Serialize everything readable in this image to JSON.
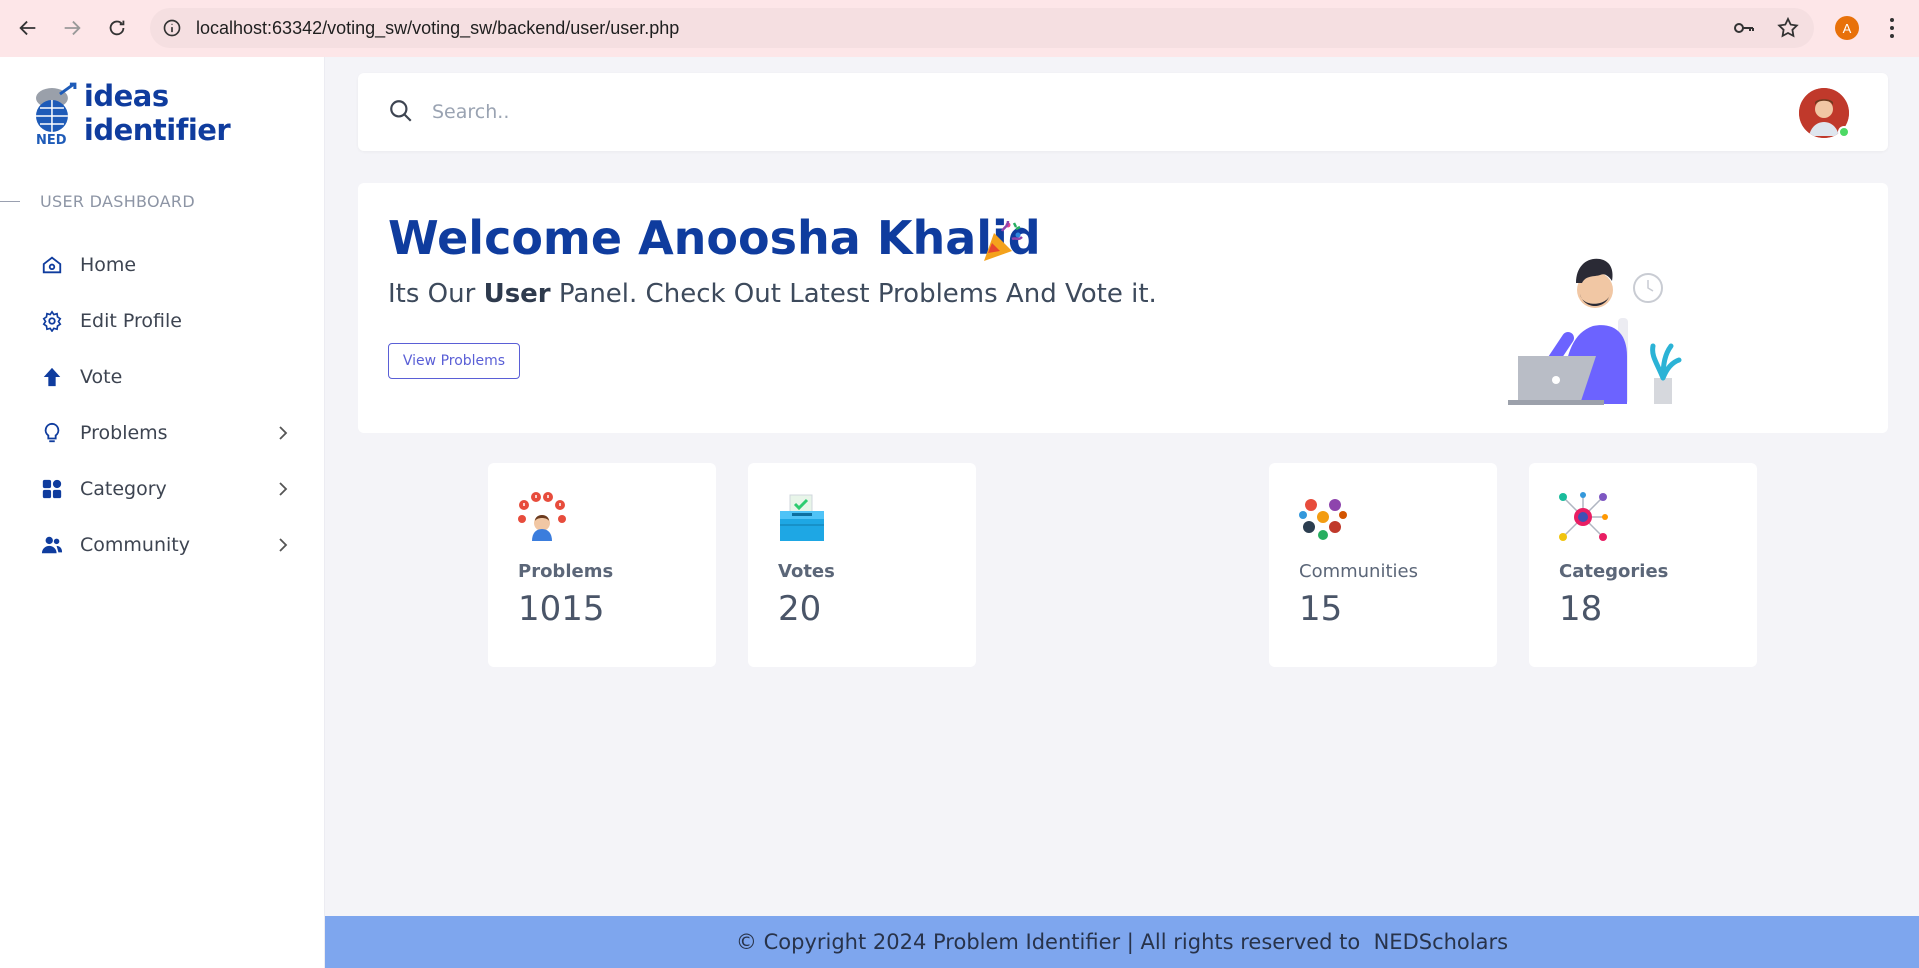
{
  "browser": {
    "url": "localhost:63342/voting_sw/voting_sw/backend/user/user.php",
    "profile_initial": "A"
  },
  "sidebar": {
    "brand_name": "ideas identifier",
    "section_title": "USER DASHBOARD",
    "items": [
      {
        "label": "Home",
        "icon": "home-icon",
        "has_chevron": false
      },
      {
        "label": "Edit Profile",
        "icon": "gear-icon",
        "has_chevron": false
      },
      {
        "label": "Vote",
        "icon": "arrow-up-icon",
        "has_chevron": false
      },
      {
        "label": "Problems",
        "icon": "lightbulb-icon",
        "has_chevron": true
      },
      {
        "label": "Category",
        "icon": "grid-icon",
        "has_chevron": true
      },
      {
        "label": "Community",
        "icon": "users-icon",
        "has_chevron": true
      }
    ]
  },
  "search": {
    "placeholder": "Search.."
  },
  "welcome": {
    "title": "Welcome Anoosha Khalid",
    "subtitle_prefix": "Its Our ",
    "subtitle_bold": "User",
    "subtitle_suffix": " Panel. Check Out Latest Problems And Vote it.",
    "button_label": "View Problems"
  },
  "stats": [
    {
      "label": "Problems",
      "value": "1015"
    },
    {
      "label": "Votes",
      "value": "20"
    },
    {
      "label": "Communities",
      "value": "15"
    },
    {
      "label": "Categories",
      "value": "18"
    }
  ],
  "footer": {
    "text": "© Copyright 2024 Problem Identifier | All rights reserved to  NEDScholars"
  },
  "colors": {
    "brand": "#0f3c9e",
    "accent": "#5a5fd6",
    "footer_bg": "#7ea6ee",
    "online": "#4cd964"
  }
}
